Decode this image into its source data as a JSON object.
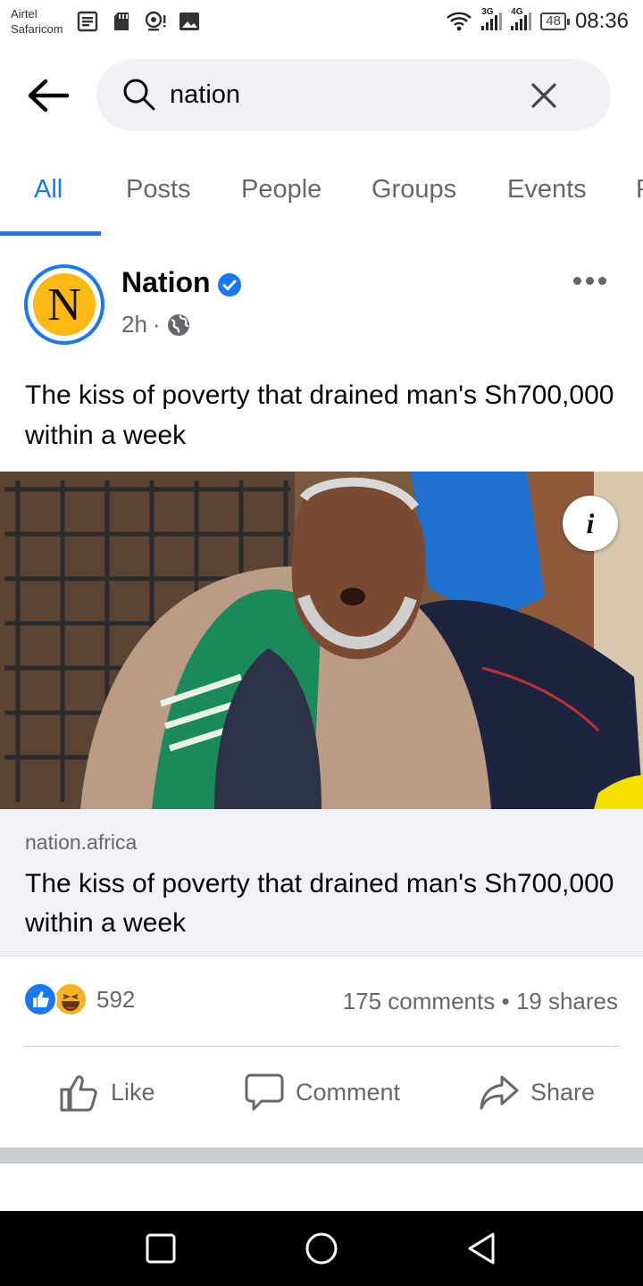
{
  "status_bar": {
    "carrier_1": "Airtel",
    "carrier_2": "Safaricom",
    "network_1": "3G",
    "network_2": "4G",
    "battery": "48",
    "time": "08:36",
    "left_icons": [
      "document-icon",
      "sd-card-icon",
      "location-alert-icon",
      "image-icon"
    ]
  },
  "search": {
    "query": "nation",
    "placeholder": "Search"
  },
  "tabs": [
    {
      "label": "All",
      "active": true
    },
    {
      "label": "Posts",
      "active": false
    },
    {
      "label": "People",
      "active": false
    },
    {
      "label": "Groups",
      "active": false
    },
    {
      "label": "Events",
      "active": false
    },
    {
      "label": "P",
      "active": false
    }
  ],
  "post": {
    "page_name": "Nation",
    "avatar_letter": "N",
    "time": "2h",
    "separator": "·",
    "privacy_icon": "globe-icon",
    "text": "The kiss of poverty that drained man's Sh700,000 within a week",
    "link": {
      "domain": "nation.africa",
      "title": "The kiss of poverty that drained man's Sh700,000 within a week"
    },
    "reaction_count": "592",
    "comments": "175 comments",
    "dot": "•",
    "shares": "19 shares",
    "actions": {
      "like": "Like",
      "comment": "Comment",
      "share": "Share"
    },
    "info_label": "i"
  },
  "colors": {
    "accent": "#1877f2",
    "secondary_text": "#65676b",
    "search_bg": "#eff1f4",
    "link_bg": "#f0f2f5"
  }
}
